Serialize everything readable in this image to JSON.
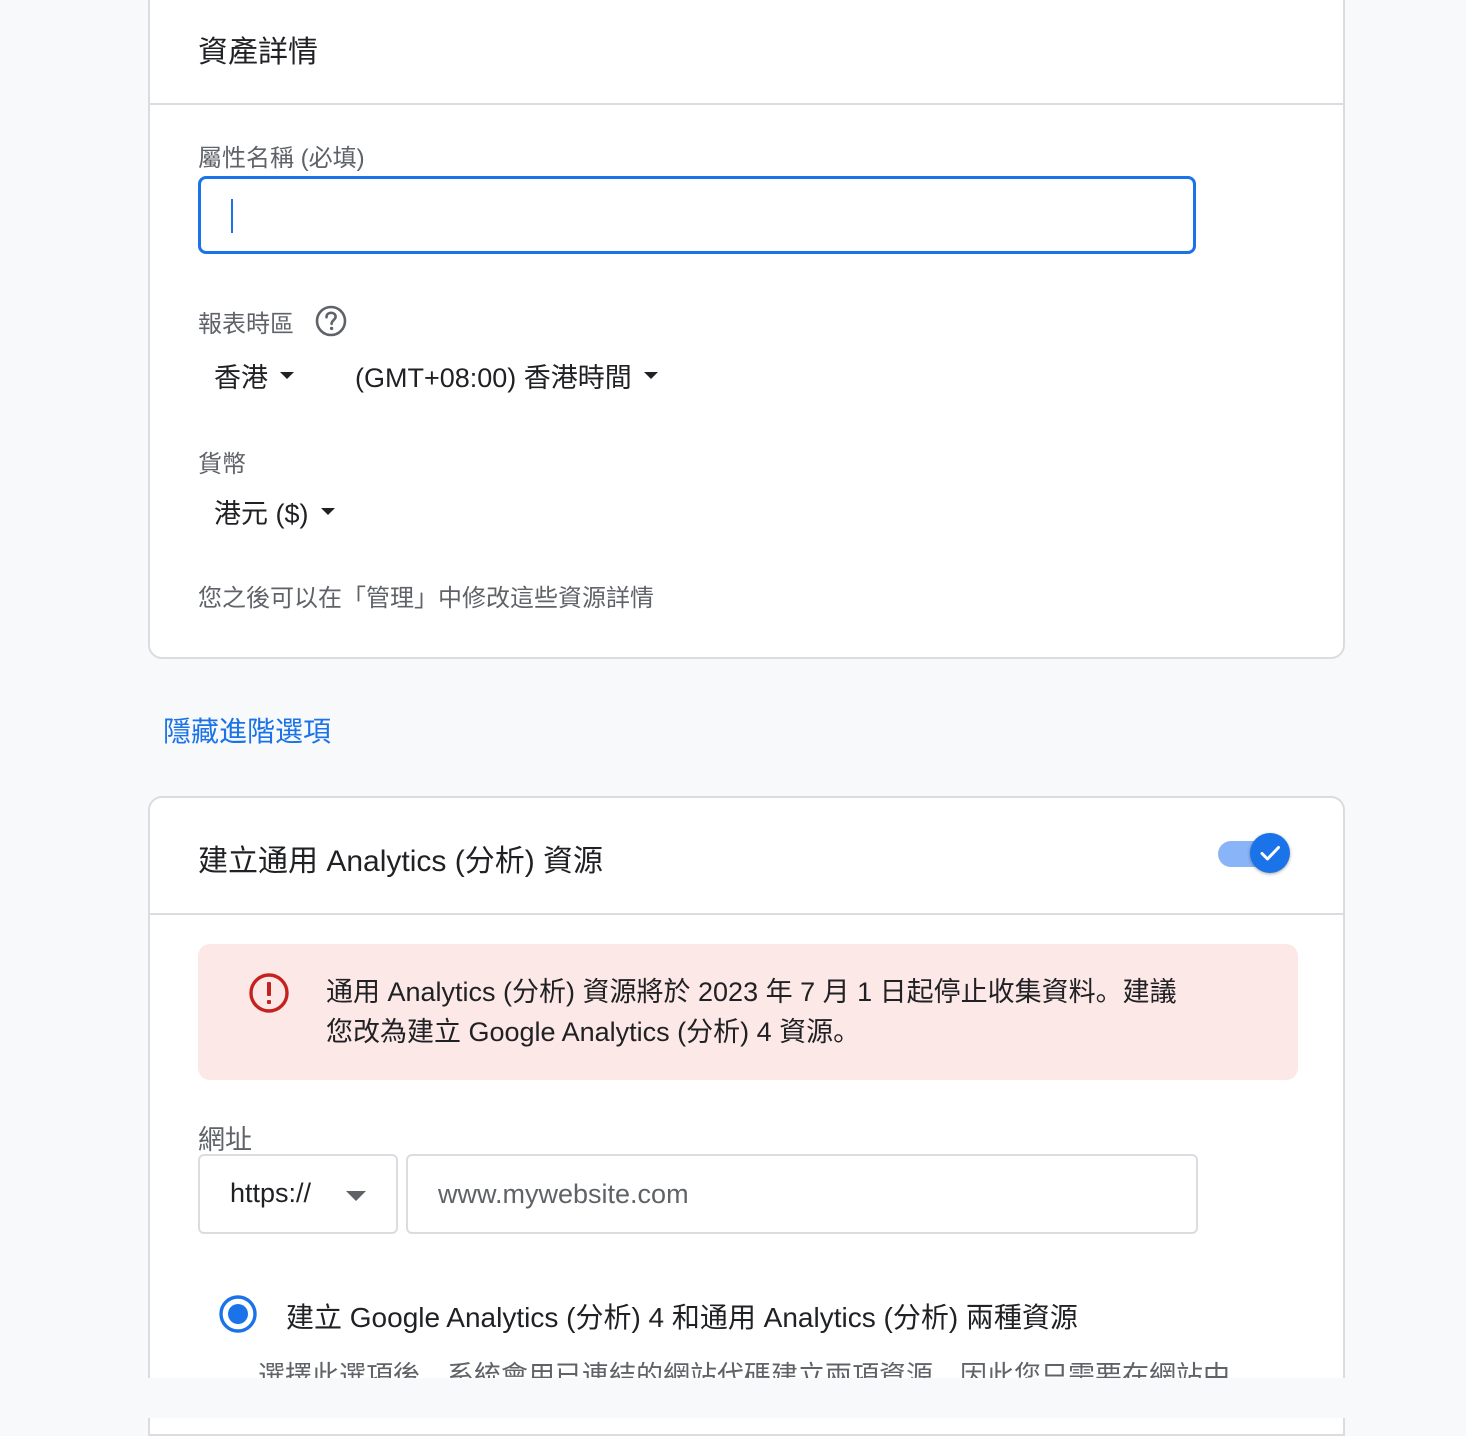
{
  "property_details": {
    "title": "資產詳情",
    "name_label": "屬性名稱 (必填)",
    "name_value": "",
    "timezone_label": "報表時區",
    "timezone_country": "香港",
    "timezone_value": "(GMT+08:00) 香港時間",
    "currency_label": "貨幣",
    "currency_value": "港元 ($)",
    "hint": "您之後可以在「管理」中修改這些資源詳情"
  },
  "advanced_toggle_link": "隱藏進階選項",
  "universal_analytics": {
    "title": "建立通用 Analytics (分析) 資源",
    "toggle_on": true,
    "alert": {
      "line1": "通用 Analytics (分析) 資源將於 2023 年 7 月 1 日起停止收集資料。建議",
      "line2": "您改為建立 Google Analytics (分析) 4 資源。"
    },
    "url_label": "網址",
    "protocol_value": "https://",
    "url_placeholder": "www.mywebsite.com",
    "radio_option_label": "建立 Google Analytics (分析) 4 和通用 Analytics (分析) 兩種資源",
    "radio_option_desc": "選擇此選項後，系統會用已連結的網站代碼建立兩項資源，因此您只需要在網站中"
  },
  "colors": {
    "accent": "#1a73e8",
    "alert_bg": "#fce8e6",
    "alert_icon": "#c5221f"
  },
  "icons": {
    "help": "help-circle-icon",
    "alert": "error-circle-icon",
    "toggle_check": "check-icon",
    "dropdown": "triangle-down-icon"
  }
}
